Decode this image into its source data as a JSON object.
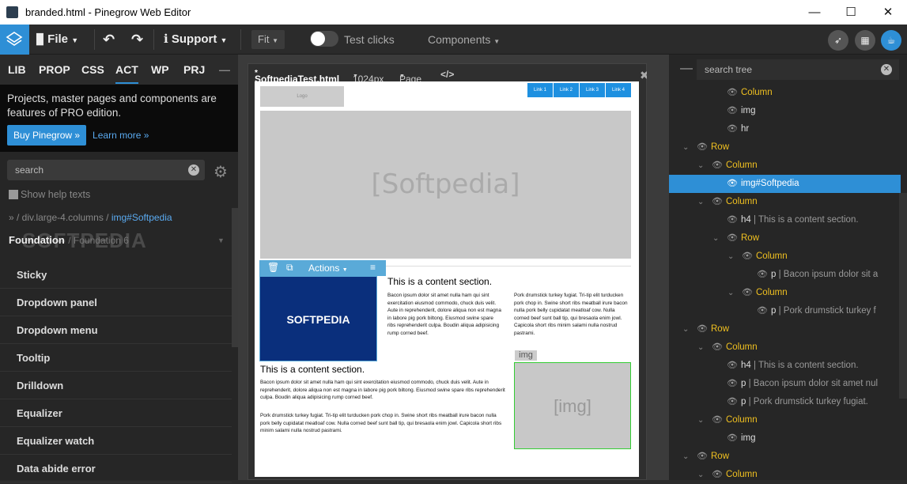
{
  "window": {
    "title": "branded.html - Pinegrow Web Editor",
    "min_glyph": "—",
    "max_glyph": "☐",
    "close_glyph": "✕"
  },
  "toolbar": {
    "file_label": "File",
    "support_label": "Support",
    "fit_label": "Fit",
    "test_clicks_label": "Test clicks",
    "components_label": "Components"
  },
  "left": {
    "tabs": [
      "LIB",
      "PROP",
      "CSS",
      "ACT",
      "WP",
      "PRJ"
    ],
    "collapse_glyph": "—",
    "promo_text": "Projects, master pages and components are features of PRO edition.",
    "buy_label": "Buy Pinegrow »",
    "learn_label": "Learn more »",
    "search_placeholder": "search",
    "show_help_label": "Show help texts",
    "crumb_prefix": "» / div.large-4.columns / ",
    "crumb_current": "img#Softpedia",
    "framework_name": "Foundation",
    "framework_version": "/ Foundation 6",
    "watermark": "SOFTPEDIA",
    "components": [
      "Sticky",
      "Dropdown panel",
      "Dropdown menu",
      "Tooltip",
      "Drilldown",
      "Equalizer",
      "Equalizer watch",
      "Data abide error"
    ]
  },
  "editor": {
    "file_tab": "SoftpediaTest.html",
    "modified_mark": "*",
    "width_label": "1024px",
    "page_label": "Page",
    "code_glyph": "</>",
    "close_glyph": "✖",
    "logo_text": "Logo",
    "nav_links": [
      "Link 1",
      "Link 2",
      "Link 3",
      "Link 4"
    ],
    "hero_text": "[Softpedia]",
    "actions_label": "Actions",
    "softpedia_img_text": "SOFTPEDIA",
    "heading1": "This is a content section.",
    "p1": "Bacon ipsum dolor sit amet nulla ham qui sint exercitation eiusmod commodo, chuck duis velit. Aute in reprehenderit, dolore aliqua non est magna in labore pig pork biltong. Eiusmod swine spare ribs reprehenderit culpa. Boudin aliqua adipisicing rump corned beef.",
    "p2": "Pork drumstick turkey fugiat. Tri-tip elit turducken pork chop in. Swine short ribs meatball irure bacon nulla pork belly cupidatat meatloaf cow. Nulla corned beef sunt ball tip, qui bresaola enim jowl. Capicola short ribs minim salami nulla nostrud pastrami.",
    "heading2": "This is a content section.",
    "p3": "Bacon ipsum dolor sit amet nulla ham qui sint exercitation eiusmod commodo, chuck duis velit. Aute in reprehenderit, dolore aliqua non est magna in labore pig pork biltong. Eiusmod swine spare ribs reprehenderit culpa. Boudin aliqua adipisicing rump corned beef.",
    "p4": "Pork drumstick turkey fugiat. Tri-tip elit turducken pork chop in. Swine short ribs meatball irure bacon nulla pork belly cupidatat meatloaf cow. Nulla corned beef sunt ball tip, qui bresaola enim jowl. Capicola short ribs minim salami nulla nostrud pastrami.",
    "img_tag": "img",
    "img_placeholder": "[img]"
  },
  "tree": {
    "search_placeholder": "search tree",
    "nodes": [
      {
        "label": "Column",
        "kind": "y",
        "depth": 3,
        "caret": false
      },
      {
        "label": "img",
        "kind": "w",
        "depth": 3,
        "caret": false
      },
      {
        "label": "hr",
        "kind": "w",
        "depth": 3,
        "caret": false
      },
      {
        "label": "Row",
        "kind": "y",
        "depth": 1,
        "caret": true
      },
      {
        "label": "Column",
        "kind": "y",
        "depth": 2,
        "caret": true
      },
      {
        "label": "img#Softpedia",
        "kind": "w",
        "depth": 3,
        "caret": false,
        "selected": true
      },
      {
        "label": "Column",
        "kind": "y",
        "depth": 2,
        "caret": true
      },
      {
        "label": "h4",
        "kind": "w",
        "depth": 3,
        "caret": false,
        "detail": " | This is a content section."
      },
      {
        "label": "Row",
        "kind": "y",
        "depth": 3,
        "caret": true
      },
      {
        "label": "Column",
        "kind": "y",
        "depth": 4,
        "caret": true
      },
      {
        "label": "p",
        "kind": "w",
        "depth": 5,
        "caret": false,
        "detail": " | Bacon ipsum dolor sit a"
      },
      {
        "label": "Column",
        "kind": "y",
        "depth": 4,
        "caret": true
      },
      {
        "label": "p",
        "kind": "w",
        "depth": 5,
        "caret": false,
        "detail": " | Pork drumstick turkey f"
      },
      {
        "label": "Row",
        "kind": "y",
        "depth": 1,
        "caret": true
      },
      {
        "label": "Column",
        "kind": "y",
        "depth": 2,
        "caret": true
      },
      {
        "label": "h4",
        "kind": "w",
        "depth": 3,
        "caret": false,
        "detail": " | This is a content section."
      },
      {
        "label": "p",
        "kind": "w",
        "depth": 3,
        "caret": false,
        "detail": " | Bacon ipsum dolor sit amet nul"
      },
      {
        "label": "p",
        "kind": "w",
        "depth": 3,
        "caret": false,
        "detail": " | Pork drumstick turkey fugiat."
      },
      {
        "label": "Column",
        "kind": "y",
        "depth": 2,
        "caret": true
      },
      {
        "label": "img",
        "kind": "w",
        "depth": 3,
        "caret": false
      },
      {
        "label": "Row",
        "kind": "y",
        "depth": 1,
        "caret": true
      },
      {
        "label": "Column",
        "kind": "y",
        "depth": 2,
        "caret": true
      }
    ]
  }
}
